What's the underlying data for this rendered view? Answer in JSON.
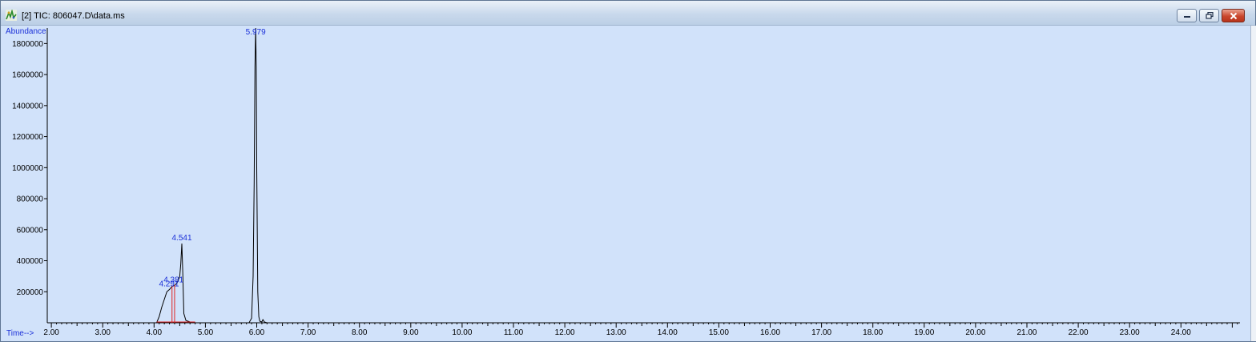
{
  "window": {
    "title": "[2] TIC: 806047.D\\data.ms",
    "icon": "chromatogram-app-icon",
    "controls": [
      "minimize-icon",
      "restore-icon",
      "close-icon"
    ]
  },
  "chart_data": {
    "type": "line",
    "ylabel": "Abundance",
    "xlabel": "Time-->",
    "xlim": [
      1.92,
      25.15
    ],
    "ylim": [
      0,
      1900000
    ],
    "xticks": [
      "2.00",
      "3.00",
      "4.00",
      "5.00",
      "6.00",
      "7.00",
      "8.00",
      "9.00",
      "10.00",
      "11.00",
      "12.00",
      "13.00",
      "14.00",
      "15.00",
      "16.00",
      "17.00",
      "18.00",
      "19.00",
      "20.00",
      "21.00",
      "22.00",
      "23.00",
      "24.00"
    ],
    "yticks": [
      "200000",
      "400000",
      "600000",
      "800000",
      "1000000",
      "1200000",
      "1400000",
      "1600000",
      "1800000"
    ],
    "grid": false,
    "series": [
      {
        "x": [
          1.92,
          4.05,
          4.1,
          4.15,
          4.2,
          4.25,
          4.3,
          4.35,
          4.4,
          4.45,
          4.5,
          4.52,
          4.541,
          4.56,
          4.58,
          4.62,
          4.7,
          4.8,
          5.85,
          5.9,
          5.93,
          5.95,
          5.965,
          5.979,
          5.99,
          6.0,
          6.02,
          6.04,
          6.06,
          6.1,
          6.12,
          6.15,
          6.2,
          25.15
        ],
        "y": [
          0,
          0,
          40000,
          100000,
          150000,
          200000,
          215000,
          235000,
          240000,
          258000,
          300000,
          380000,
          510000,
          320000,
          60000,
          15000,
          5000,
          0,
          0,
          30000,
          300000,
          900000,
          1650000,
          1900000,
          1650000,
          1000000,
          200000,
          40000,
          10000,
          5000,
          20000,
          5000,
          0,
          0
        ],
        "color": "#000000"
      }
    ],
    "annotations": [
      {
        "text": "4.541",
        "x": 4.541,
        "y": 510000
      },
      {
        "text": "4.291",
        "x": 4.291,
        "y": 215000
      },
      {
        "text": "4.381",
        "x": 4.381,
        "y": 240000
      },
      {
        "text": "5.979",
        "x": 5.979,
        "y": 1900000
      }
    ],
    "integration_marks": [
      {
        "x": 4.35,
        "y": 240000
      },
      {
        "x": 4.4,
        "y": 245000
      }
    ],
    "colors": {
      "background": "#d1e2fa",
      "trace": "#000000",
      "labels": "#1a2fd8",
      "integration": "#e02020"
    }
  }
}
